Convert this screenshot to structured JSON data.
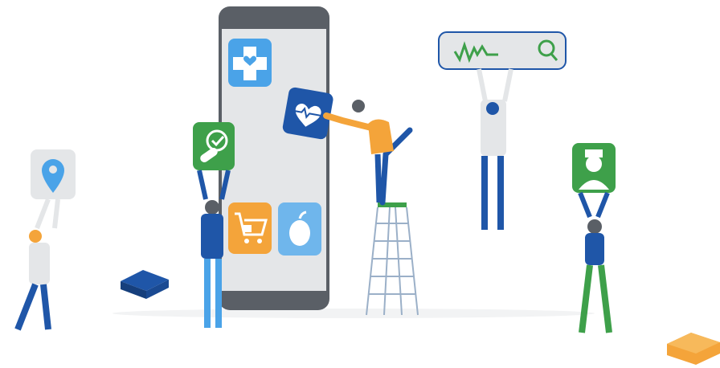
{
  "illustration": {
    "phone": {
      "body_color": "#e4e6e8",
      "frame_color": "#5a5f66"
    },
    "app_tiles": [
      {
        "name": "medical-cross",
        "icon": "medical-cross-heart-icon",
        "color": "#4aa3e8"
      },
      {
        "name": "heart-monitor",
        "icon": "heart-pulse-icon",
        "color": "#1f56a8"
      },
      {
        "name": "medication-check",
        "icon": "pill-checkmark-icon",
        "color": "#3ea04a"
      },
      {
        "name": "grocery-cart",
        "icon": "shopping-cart-icon",
        "color": "#f4a43a"
      },
      {
        "name": "nutrition",
        "icon": "apple-icon",
        "color": "#6fb6ec"
      },
      {
        "name": "location",
        "icon": "location-pin-icon",
        "color": "#4aa3e8"
      },
      {
        "name": "doctor-profile",
        "icon": "doctor-avatar-icon",
        "color": "#3ea04a"
      }
    ],
    "search_sign": {
      "icon": "heartbeat-search-icon",
      "accent": "#3ea04a"
    },
    "colors": {
      "primary_blue": "#1f56a8",
      "light_blue": "#4aa3e8",
      "orange": "#f4a43a",
      "green": "#3ea04a",
      "grey": "#e4e6e8"
    }
  }
}
